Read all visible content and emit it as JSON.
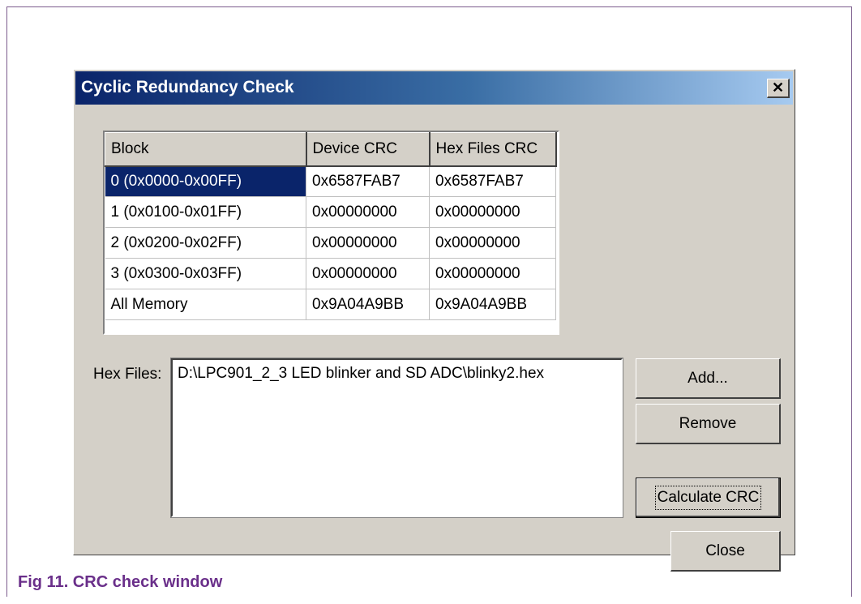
{
  "dialog": {
    "title": "Cyclic Redundancy Check",
    "close_glyph": "✕"
  },
  "table": {
    "headers": [
      "Block",
      "Device CRC",
      "Hex Files CRC"
    ],
    "rows": [
      [
        "0 (0x0000-0x00FF)",
        "0x6587FAB7",
        "0x6587FAB7"
      ],
      [
        "1 (0x0100-0x01FF)",
        "0x00000000",
        "0x00000000"
      ],
      [
        "2 (0x0200-0x02FF)",
        "0x00000000",
        "0x00000000"
      ],
      [
        "3 (0x0300-0x03FF)",
        "0x00000000",
        "0x00000000"
      ],
      [
        "All Memory",
        "0x9A04A9BB",
        "0x9A04A9BB"
      ]
    ],
    "selected_row": 0
  },
  "hex_files": {
    "label": "Hex Files:",
    "items": [
      "D:\\LPC901_2_3 LED blinker and SD ADC\\blinky2.hex"
    ]
  },
  "buttons": {
    "add": "Add...",
    "remove": "Remove",
    "calculate": "Calculate CRC",
    "close": "Close"
  },
  "caption": "Fig 11.  CRC check window",
  "colors": {
    "title_gradient_start": "#0a246a",
    "title_gradient_end": "#a6caf0",
    "dialog_face": "#d4d0c8",
    "selection": "#0a246a",
    "caption": "#6a2f8a"
  }
}
